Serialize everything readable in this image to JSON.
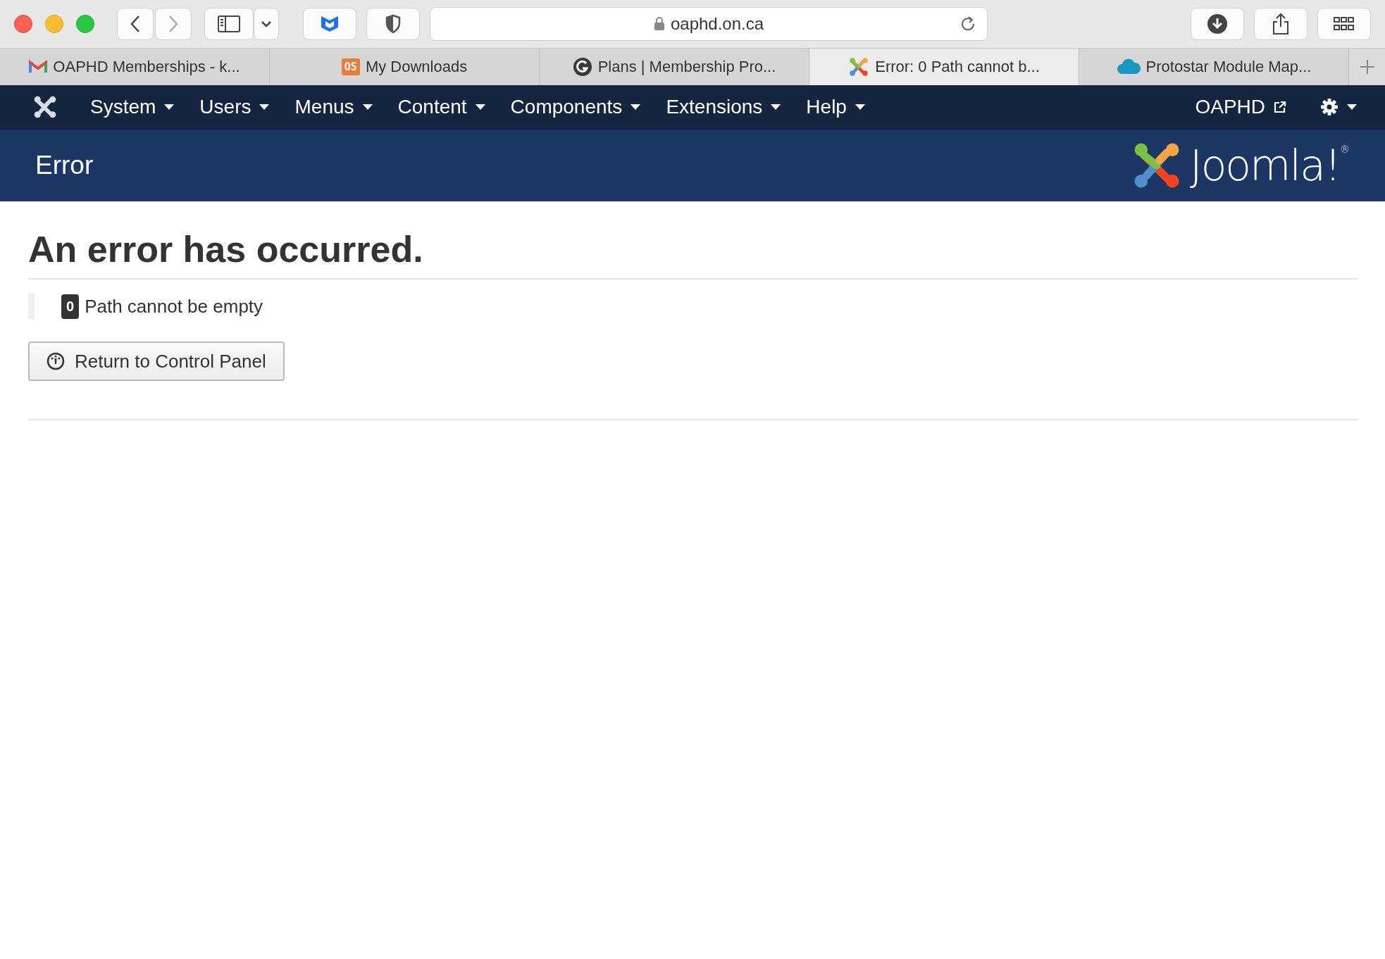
{
  "browser": {
    "address": "oaphd.on.ca",
    "tabs": [
      {
        "title": "OAPHD Memberships - k...",
        "selected": false
      },
      {
        "title": "My Downloads",
        "badge": "OS",
        "selected": false
      },
      {
        "title": "Plans | Membership Pro...",
        "selected": false
      },
      {
        "title": "Error: 0 Path cannot b...",
        "selected": true
      },
      {
        "title": "Protostar Module Map...",
        "selected": false
      }
    ]
  },
  "admin_menu": {
    "items": [
      "System",
      "Users",
      "Menus",
      "Content",
      "Components",
      "Extensions",
      "Help"
    ],
    "site_link": "OAPHD"
  },
  "header": {
    "title": "Error",
    "logo_text": "Joomla!",
    "logo_mark": "®"
  },
  "error": {
    "heading": "An error has occurred.",
    "code": "0",
    "message": "Path cannot be empty",
    "button": "Return to Control Panel"
  }
}
